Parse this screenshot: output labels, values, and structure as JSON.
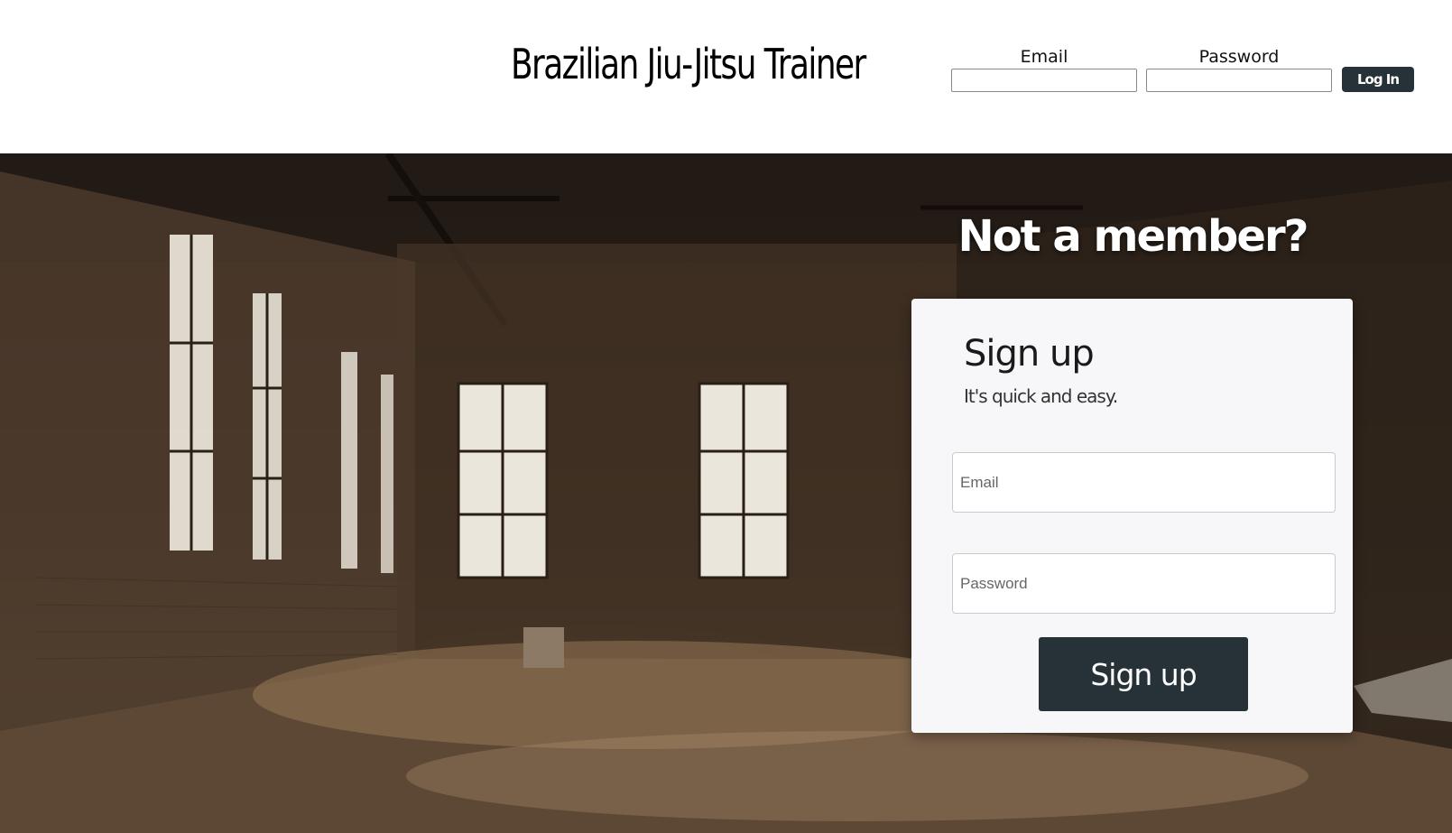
{
  "header": {
    "title": "Brazilian Jiu-Jitsu Trainer",
    "login": {
      "email_label": "Email",
      "password_label": "Password",
      "button_label": "Log In"
    }
  },
  "hero": {
    "heading": "Not a member?",
    "background_image": "abandoned-brick-warehouse-photo"
  },
  "signup": {
    "title": "Sign up",
    "subtitle": "It's quick and easy.",
    "email_placeholder": "Email",
    "password_placeholder": "Password",
    "button_label": "Sign up"
  },
  "colors": {
    "button_bg": "#263238",
    "card_bg": "#f7f7f9",
    "header_bg": "#ffffff"
  }
}
